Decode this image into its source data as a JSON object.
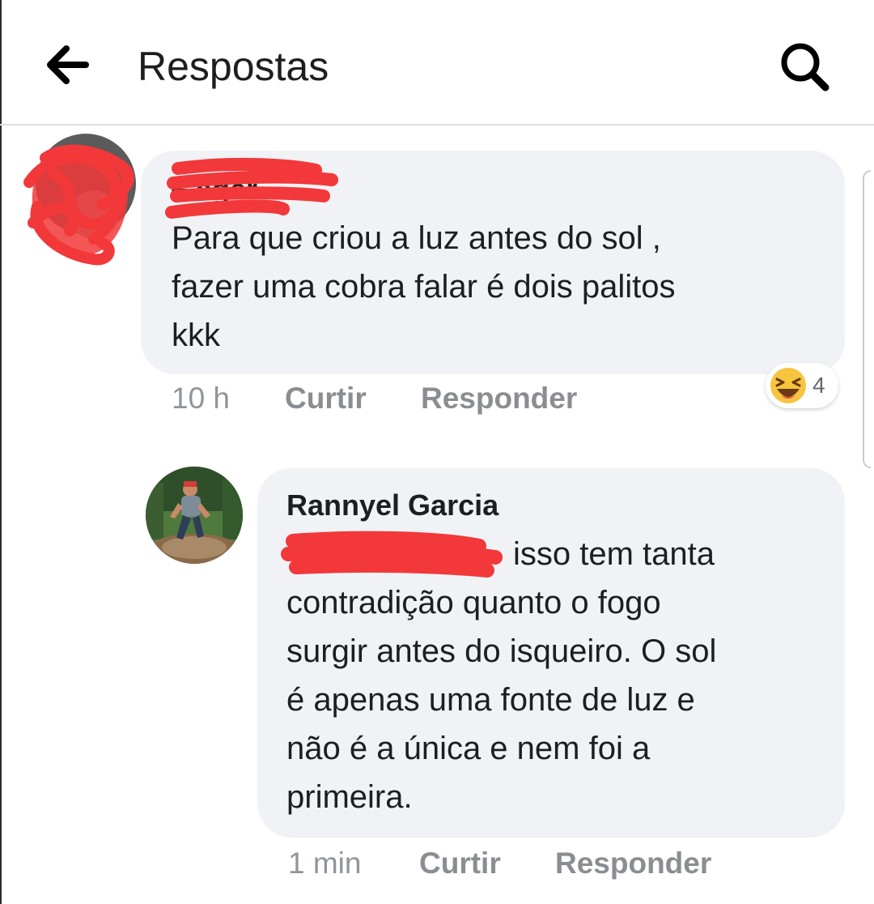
{
  "header": {
    "title": "Respostas",
    "back_icon": "arrow-left-icon",
    "search_icon": "search-icon"
  },
  "comments": [
    {
      "author_partial": "F       ager",
      "lines": [
        "Para que criou a luz antes do sol ,",
        "fazer uma cobra falar é  dois palitos",
        "kkk"
      ],
      "time": "10 h",
      "like_label": "Curtir",
      "reply_label": "Responder",
      "reaction": {
        "icon": "laughing-emoji-icon",
        "count": "4"
      }
    },
    {
      "author": "Rannyel Garcia",
      "lines": [
        "isso tem tanta",
        "contradição quanto o fogo",
        "surgir antes do isqueiro. O sol",
        "é apenas uma fonte de luz e",
        "não é a única e nem foi a",
        "primeira."
      ],
      "time": "1 min",
      "like_label": "Curtir",
      "reply_label": "Responder"
    }
  ],
  "colors": {
    "bubble": "#f0f2f5",
    "text": "#1c1e21",
    "meta": "#8a8d91",
    "redaction": "#f2383a"
  }
}
